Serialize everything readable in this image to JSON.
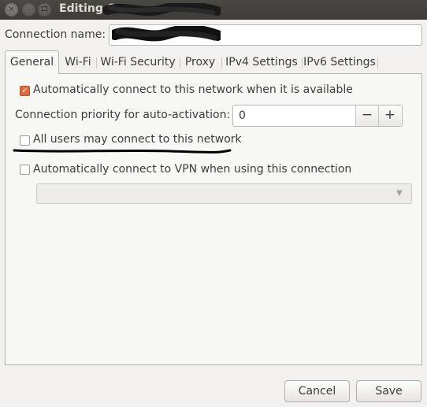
{
  "window": {
    "title": "Editing C",
    "title_obscured": true
  },
  "connection": {
    "name_label": "Connection name:",
    "name_value": "",
    "name_obscured": true
  },
  "tabs": [
    {
      "label": "General",
      "active": true
    },
    {
      "label": "Wi-Fi",
      "active": false
    },
    {
      "label": "Wi-Fi Security",
      "active": false
    },
    {
      "label": "Proxy",
      "active": false
    },
    {
      "label": "IPv4 Settings",
      "active": false
    },
    {
      "label": "IPv6 Settings",
      "active": false
    }
  ],
  "general": {
    "auto_connect": {
      "label": "Automatically connect to this network when it is available",
      "checked": true
    },
    "priority": {
      "label": "Connection priority for auto-activation:",
      "value": "0",
      "minus": "−",
      "plus": "+"
    },
    "all_users": {
      "label": "All users may connect to this network",
      "checked": false
    },
    "vpn": {
      "label": "Automatically connect to VPN when using this connection",
      "checked": false,
      "selected": ""
    }
  },
  "buttons": {
    "cancel": "Cancel",
    "save": "Save"
  },
  "colors": {
    "accent": "#e1693e",
    "titlebar": "#3c3b37",
    "annotation_ink": "#000000"
  }
}
